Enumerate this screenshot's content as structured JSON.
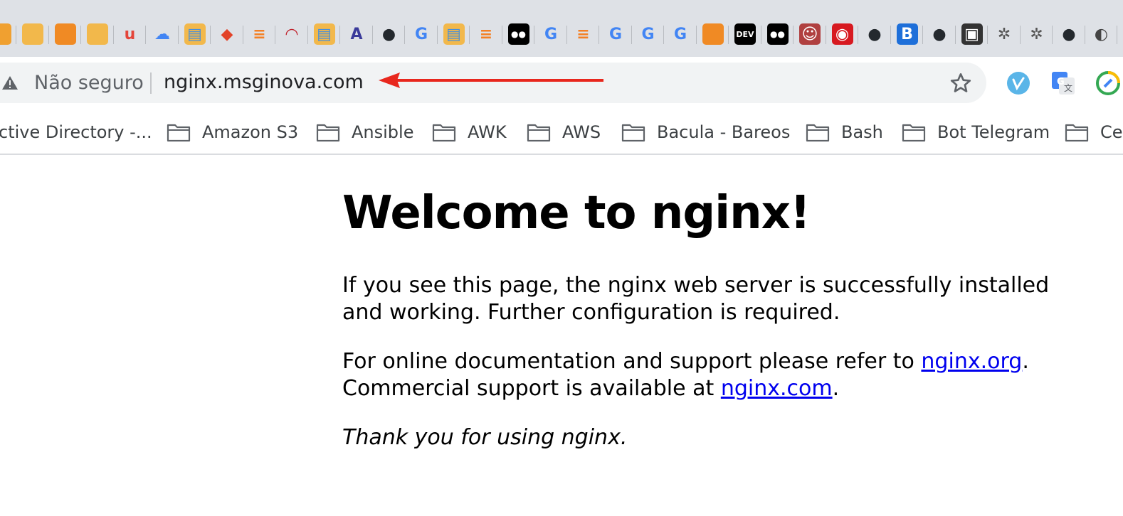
{
  "tabs": {
    "icons": [
      {
        "name": "amazon-box-icon",
        "glyph": "",
        "bg": "#f0a030",
        "fg": "#ffffff"
      },
      {
        "name": "amazon-box-icon",
        "glyph": "",
        "bg": "#f2b84b",
        "fg": "#ffffff"
      },
      {
        "name": "aws-cube-icon",
        "glyph": "",
        "bg": "#f08a24",
        "fg": "#ffffff"
      },
      {
        "name": "amazon-box-icon",
        "glyph": "",
        "bg": "#f2b84b",
        "fg": "#ffffff"
      },
      {
        "name": "udemy-icon",
        "glyph": "u",
        "bg": "transparent",
        "fg": "#e4453a"
      },
      {
        "name": "google-cloud-icon",
        "glyph": "☁",
        "bg": "transparent",
        "fg": "#4285f4"
      },
      {
        "name": "book-icon",
        "glyph": "▤",
        "bg": "#f2b84b",
        "fg": "#4a90d9"
      },
      {
        "name": "gitlab-icon",
        "glyph": "◆",
        "bg": "transparent",
        "fg": "#e24329"
      },
      {
        "name": "stackoverflow-icon",
        "glyph": "≡",
        "bg": "transparent",
        "fg": "#f48024"
      },
      {
        "name": "redash-icon",
        "glyph": "◠",
        "bg": "transparent",
        "fg": "#c0202a"
      },
      {
        "name": "book-icon",
        "glyph": "▤",
        "bg": "#f2b84b",
        "fg": "#4a90d9"
      },
      {
        "name": "aws-a-icon",
        "glyph": "A",
        "bg": "transparent",
        "fg": "#3a3a9a"
      },
      {
        "name": "github-icon",
        "glyph": "●",
        "bg": "transparent",
        "fg": "#24292e"
      },
      {
        "name": "google-icon",
        "glyph": "G",
        "bg": "transparent",
        "fg": "#4285f4"
      },
      {
        "name": "book-icon",
        "glyph": "▤",
        "bg": "#f2b84b",
        "fg": "#4a90d9"
      },
      {
        "name": "stackoverflow-icon",
        "glyph": "≡",
        "bg": "transparent",
        "fg": "#f48024"
      },
      {
        "name": "medium-icon",
        "glyph": "●●",
        "bg": "#000000",
        "fg": "#ffffff"
      },
      {
        "name": "google-icon",
        "glyph": "G",
        "bg": "transparent",
        "fg": "#4285f4"
      },
      {
        "name": "stackoverflow-icon",
        "glyph": "≡",
        "bg": "transparent",
        "fg": "#f48024"
      },
      {
        "name": "google-icon",
        "glyph": "G",
        "bg": "transparent",
        "fg": "#4285f4"
      },
      {
        "name": "google-icon",
        "glyph": "G",
        "bg": "transparent",
        "fg": "#4285f4"
      },
      {
        "name": "google-icon",
        "glyph": "G",
        "bg": "transparent",
        "fg": "#4285f4"
      },
      {
        "name": "aws-cube-icon",
        "glyph": "",
        "bg": "#f08a24",
        "fg": "#ffffff"
      },
      {
        "name": "dev-to-icon",
        "glyph": "DEV",
        "bg": "#000000",
        "fg": "#ffffff"
      },
      {
        "name": "medium-icon",
        "glyph": "●●",
        "bg": "#000000",
        "fg": "#ffffff"
      },
      {
        "name": "avatar-icon",
        "glyph": "☺",
        "bg": "#b04040",
        "fg": "#ffffff"
      },
      {
        "name": "trend-micro-icon",
        "glyph": "◉",
        "bg": "#d71920",
        "fg": "#ffffff"
      },
      {
        "name": "github-icon",
        "glyph": "●",
        "bg": "transparent",
        "fg": "#24292e"
      },
      {
        "name": "bootstrap-icon",
        "glyph": "B",
        "bg": "#1e6fd9",
        "fg": "#ffffff"
      },
      {
        "name": "github-icon",
        "glyph": "●",
        "bg": "transparent",
        "fg": "#24292e"
      },
      {
        "name": "tab-icon",
        "glyph": "▣",
        "bg": "#333333",
        "fg": "#ffffff"
      },
      {
        "name": "helm-icon",
        "glyph": "✲",
        "bg": "transparent",
        "fg": "#555555"
      },
      {
        "name": "helm-icon",
        "glyph": "✲",
        "bg": "transparent",
        "fg": "#555555"
      },
      {
        "name": "github-icon",
        "glyph": "●",
        "bg": "transparent",
        "fg": "#24292e"
      },
      {
        "name": "globe-icon",
        "glyph": "◐",
        "bg": "transparent",
        "fg": "#444444"
      }
    ]
  },
  "omnibox": {
    "security_label": "Não seguro",
    "url": "nginx.msginova.com"
  },
  "extensions": [
    {
      "name": "vimeo-extension-icon",
      "bg": "#5ab5e8"
    },
    {
      "name": "google-translate-extension-icon",
      "bg": "#4285f4"
    },
    {
      "name": "colorful-extension-icon",
      "bg": "#34a853"
    }
  ],
  "bookmarks": [
    {
      "label": "ctive Directory -..."
    },
    {
      "label": "Amazon S3"
    },
    {
      "label": "Ansible"
    },
    {
      "label": "AWK"
    },
    {
      "label": "AWS"
    },
    {
      "label": "Bacula - Bareos"
    },
    {
      "label": "Bash"
    },
    {
      "label": "Bot Telegram"
    },
    {
      "label": "Ce"
    }
  ],
  "page": {
    "heading": "Welcome to nginx!",
    "p1": "If you see this page, the nginx web server is successfully installed and working. Further configuration is required.",
    "p2_before": "For online documentation and support please refer to ",
    "p2_link": "nginx.org",
    "p2_after": ".",
    "p2_line2_before": "Commercial support is available at ",
    "p2_line2_link": "nginx.com",
    "p2_line2_after": ".",
    "p3": "Thank you for using nginx."
  },
  "colors": {
    "annotation_arrow": "#e8271d",
    "link": "#0000ee"
  }
}
